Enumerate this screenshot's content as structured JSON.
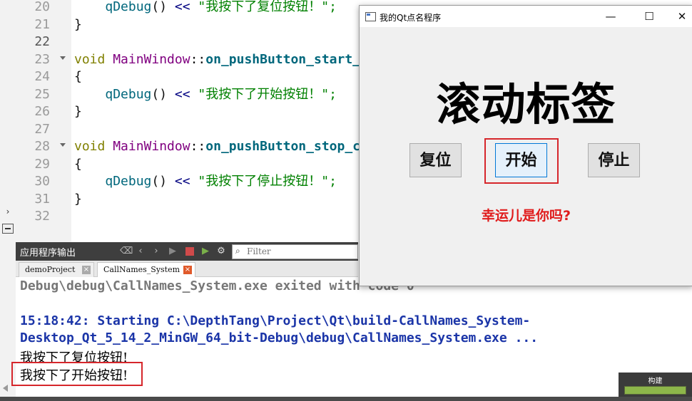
{
  "editor": {
    "lines": [
      {
        "num": "20",
        "active": false,
        "fold": false,
        "segments": [
          {
            "t": "    ",
            "c": ""
          },
          {
            "t": "qDebug",
            "c": "t-call"
          },
          {
            "t": "() ",
            "c": ""
          },
          {
            "t": "<<",
            "c": "t-op"
          },
          {
            "t": " \"我按下了复位按钮！\";",
            "c": "t-str"
          }
        ]
      },
      {
        "num": "21",
        "active": false,
        "fold": false,
        "segments": [
          {
            "t": "}",
            "c": ""
          }
        ]
      },
      {
        "num": "22",
        "active": true,
        "fold": false,
        "segments": []
      },
      {
        "num": "23",
        "active": false,
        "fold": true,
        "segments": [
          {
            "t": "void",
            "c": "t-kw"
          },
          {
            "t": " ",
            "c": ""
          },
          {
            "t": "MainWindow",
            "c": "t-cls"
          },
          {
            "t": "::",
            "c": ""
          },
          {
            "t": "on_pushButton_start_",
            "c": "t-fn"
          }
        ]
      },
      {
        "num": "24",
        "active": false,
        "fold": false,
        "segments": [
          {
            "t": "{",
            "c": ""
          }
        ]
      },
      {
        "num": "25",
        "active": false,
        "fold": false,
        "segments": [
          {
            "t": "    ",
            "c": ""
          },
          {
            "t": "qDebug",
            "c": "t-call"
          },
          {
            "t": "() ",
            "c": ""
          },
          {
            "t": "<<",
            "c": "t-op"
          },
          {
            "t": " \"我按下了开始按钮！\";",
            "c": "t-str"
          }
        ]
      },
      {
        "num": "26",
        "active": false,
        "fold": false,
        "segments": [
          {
            "t": "}",
            "c": ""
          }
        ]
      },
      {
        "num": "27",
        "active": false,
        "fold": false,
        "segments": []
      },
      {
        "num": "28",
        "active": false,
        "fold": true,
        "segments": [
          {
            "t": "void",
            "c": "t-kw"
          },
          {
            "t": " ",
            "c": ""
          },
          {
            "t": "MainWindow",
            "c": "t-cls"
          },
          {
            "t": "::",
            "c": ""
          },
          {
            "t": "on_pushButton_stop_c",
            "c": "t-fn"
          }
        ]
      },
      {
        "num": "29",
        "active": false,
        "fold": false,
        "segments": [
          {
            "t": "{",
            "c": ""
          }
        ]
      },
      {
        "num": "30",
        "active": false,
        "fold": false,
        "segments": [
          {
            "t": "    ",
            "c": ""
          },
          {
            "t": "qDebug",
            "c": "t-call"
          },
          {
            "t": "() ",
            "c": ""
          },
          {
            "t": "<<",
            "c": "t-op"
          },
          {
            "t": " \"我按下了停止按钮！\";",
            "c": "t-str"
          }
        ]
      },
      {
        "num": "31",
        "active": false,
        "fold": false,
        "segments": [
          {
            "t": "}",
            "c": ""
          }
        ]
      },
      {
        "num": "32",
        "active": false,
        "fold": false,
        "segments": []
      }
    ]
  },
  "output_pane": {
    "title": "应用程序输出",
    "filter_placeholder": "Filter",
    "tabs": [
      {
        "label": "demoProject",
        "active": false
      },
      {
        "label": "CallNames_System",
        "active": true
      }
    ],
    "lines": [
      {
        "text": "Debug\\debug\\CallNames_System.exe exited with code 0",
        "style": "gray"
      },
      {
        "text": "",
        "style": "gray"
      },
      {
        "text": "15:18:42: Starting C:\\DepthTang\\Project\\Qt\\build-CallNames_System-",
        "style": "blue"
      },
      {
        "text": "Desktop_Qt_5_14_2_MinGW_64_bit-Debug\\debug\\CallNames_System.exe ...",
        "style": "blue"
      },
      {
        "text": "我按下了复位按钮!",
        "style": "plain"
      },
      {
        "text": "我按下了开始按钮!",
        "style": "plain"
      }
    ]
  },
  "build": {
    "label": "构建",
    "progress": 1.0,
    "color": "#8db64a"
  },
  "qt_window": {
    "title": "我的Qt点名程序",
    "controls": {
      "minimize": "—",
      "maximize": "☐",
      "close": "✕"
    },
    "big_label": "滚动标签",
    "buttons": {
      "reset": "复位",
      "start": "开始",
      "stop": "停止"
    },
    "sub_label": "幸运儿是你吗?",
    "sub_label_color": "#e01b1b",
    "highlight_color": "#d6262b"
  }
}
